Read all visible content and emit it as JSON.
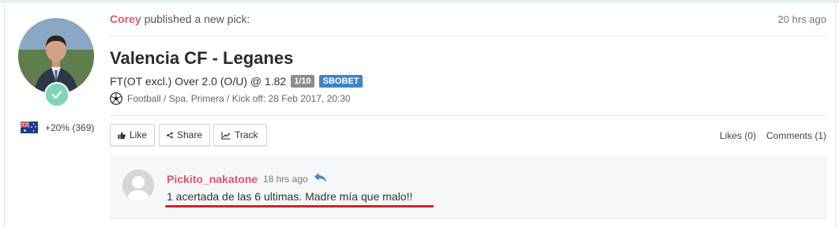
{
  "post": {
    "author": "Corey",
    "published_text": "published a new pick:",
    "time_ago": "20 hrs ago",
    "match_title": "Valencia CF - Leganes",
    "pick_text": "FT(OT excl.) Over 2.0 (O/U) @ 1.82",
    "stake": "1/10",
    "bookmaker": "SBOBET",
    "meta": "Football / Spa. Primera / Kick off: 28 Feb 2017, 20:30"
  },
  "profile": {
    "stats": "+20% (369)",
    "flag": "australia-flag"
  },
  "actions": {
    "like": "Like",
    "share": "Share",
    "track": "Track",
    "likes_count": "Likes (0)",
    "comments_count": "Comments (1)"
  },
  "comment": {
    "user": "Pickito_nakatone",
    "time": "18 hrs ago",
    "text": "1 acertada de las 6 ultimas. Madre mía que malo!!"
  },
  "colors": {
    "username": "#e0566b",
    "bookmaker_badge": "#3d86c6",
    "stake_badge": "#8c8c8c",
    "underline": "#d8202a",
    "verified": "#7fd3b8"
  }
}
